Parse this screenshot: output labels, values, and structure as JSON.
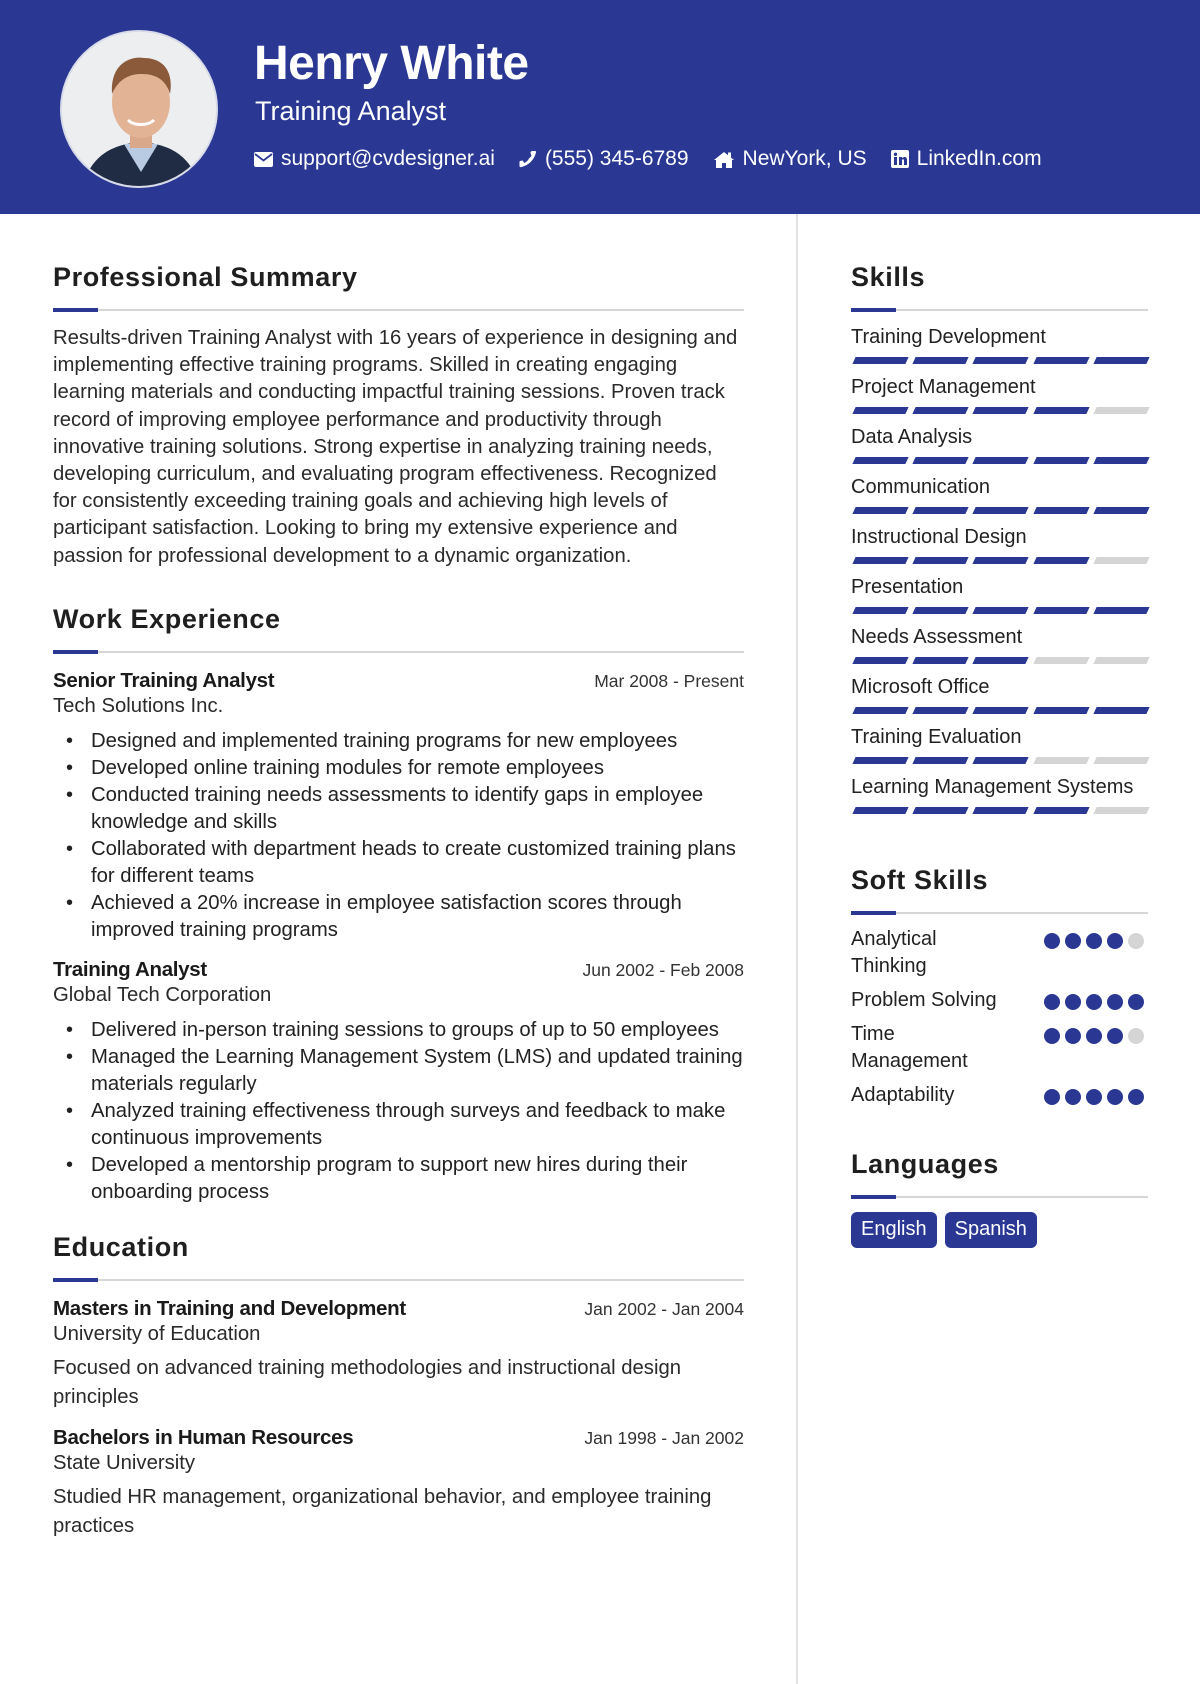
{
  "header": {
    "name": "Henry White",
    "title": "Training Analyst",
    "photo_alt": "Profile photo",
    "contacts": [
      {
        "icon": "envelope-icon",
        "text": "support@cvdesigner.ai"
      },
      {
        "icon": "phone-icon",
        "text": "(555) 345-6789"
      },
      {
        "icon": "home-icon",
        "text": "NewYork, US"
      },
      {
        "icon": "linkedin-icon",
        "text": "LinkedIn.com"
      }
    ]
  },
  "summary": {
    "heading": "Professional Summary",
    "text": "Results-driven Training Analyst with 16 years of experience in designing and implementing effective training programs. Skilled in creating engaging learning materials and conducting impactful training sessions. Proven track record of improving employee performance and productivity through innovative training solutions. Strong expertise in analyzing training needs, developing curriculum, and evaluating program effectiveness. Recognized for consistently exceeding training goals and achieving high levels of participant satisfaction. Looking to bring my extensive experience and passion for professional development to a dynamic organization."
  },
  "experience": {
    "heading": "Work Experience",
    "jobs": [
      {
        "title": "Senior Training Analyst",
        "dates": "Mar 2008 - Present",
        "company": "Tech Solutions Inc.",
        "bullets": [
          "Designed and implemented training programs for new employees",
          "Developed online training modules for remote employees",
          "Conducted training needs assessments to identify gaps in employee knowledge and skills",
          "Collaborated with department heads to create customized training plans for different teams",
          "Achieved a 20% increase in employee satisfaction scores through improved training programs"
        ]
      },
      {
        "title": "Training Analyst",
        "dates": "Jun 2002 - Feb 2008",
        "company": "Global Tech Corporation",
        "bullets": [
          "Delivered in-person training sessions to groups of up to 50 employees",
          "Managed the Learning Management System (LMS) and updated training materials regularly",
          "Analyzed training effectiveness through surveys and feedback to make continuous improvements",
          "Developed a mentorship program to support new hires during their onboarding process"
        ]
      }
    ]
  },
  "education": {
    "heading": "Education",
    "items": [
      {
        "degree": "Masters in Training and Development",
        "dates": "Jan 2002 - Jan 2004",
        "school": "University of Education",
        "description": "Focused on advanced training methodologies and instructional design principles"
      },
      {
        "degree": "Bachelors in Human Resources",
        "dates": "Jan 1998 - Jan 2002",
        "school": "State University",
        "description": "Studied HR management, organizational behavior, and employee training practices"
      }
    ]
  },
  "skills": {
    "heading": "Skills",
    "max_level": 5,
    "items": [
      {
        "name": "Training Development",
        "level": 5
      },
      {
        "name": "Project Management",
        "level": 4
      },
      {
        "name": "Data Analysis",
        "level": 5
      },
      {
        "name": "Communication",
        "level": 5
      },
      {
        "name": "Instructional Design",
        "level": 4
      },
      {
        "name": "Presentation",
        "level": 5
      },
      {
        "name": "Needs Assessment",
        "level": 3
      },
      {
        "name": "Microsoft Office",
        "level": 5
      },
      {
        "name": "Training Evaluation",
        "level": 3
      },
      {
        "name": "Learning Management Systems",
        "level": 4
      }
    ]
  },
  "soft_skills": {
    "heading": "Soft Skills",
    "max_level": 5,
    "items": [
      {
        "name": "Analytical Thinking",
        "level": 4
      },
      {
        "name": "Problem Solving",
        "level": 5
      },
      {
        "name": "Time Management",
        "level": 4
      },
      {
        "name": "Adaptability",
        "level": 5
      }
    ]
  },
  "languages": {
    "heading": "Languages",
    "items": [
      "English",
      "Spanish"
    ]
  },
  "colors": {
    "accent": "#2a3894",
    "inactive": "#d5d5d5",
    "rule": "#d6d6d6"
  }
}
